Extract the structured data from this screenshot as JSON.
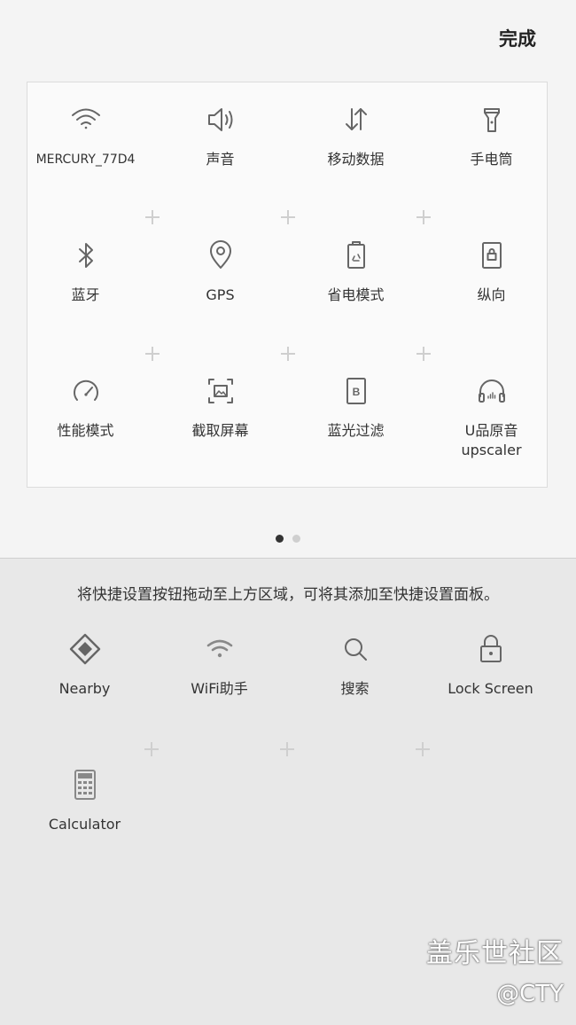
{
  "header": {
    "done_label": "完成"
  },
  "active_tiles": [
    {
      "label": "MERCURY_77D4",
      "icon": "wifi-icon"
    },
    {
      "label": "声音",
      "icon": "speaker-icon"
    },
    {
      "label": "移动数据",
      "icon": "mobile-data-icon"
    },
    {
      "label": "手电筒",
      "icon": "flashlight-icon"
    },
    {
      "label": "蓝牙",
      "icon": "bluetooth-icon"
    },
    {
      "label": "GPS",
      "icon": "location-pin-icon"
    },
    {
      "label": "省电模式",
      "icon": "battery-saver-icon"
    },
    {
      "label": "纵向",
      "icon": "portrait-lock-icon"
    },
    {
      "label": "性能模式",
      "icon": "speedometer-icon"
    },
    {
      "label": "截取屏幕",
      "icon": "screenshot-icon"
    },
    {
      "label": "蓝光过滤",
      "icon": "blue-light-filter-icon"
    },
    {
      "label": "U品原音\nupscaler",
      "icon": "headphones-icon"
    }
  ],
  "pagination": {
    "pages": 2,
    "current": 1
  },
  "available": {
    "instruction": "将快捷设置按钮拖动至上方区域，可将其添加至快捷设置面板。",
    "tiles": [
      {
        "label": "Nearby",
        "icon": "nearby-icon"
      },
      {
        "label": "WiFi助手",
        "icon": "wifi-assistant-icon"
      },
      {
        "label": "搜索",
        "icon": "search-icon"
      },
      {
        "label": "Lock Screen",
        "icon": "lock-icon"
      },
      {
        "label": "Calculator",
        "icon": "calculator-icon"
      }
    ]
  },
  "watermark": {
    "title": "盖乐世社区",
    "author": "@CTY"
  }
}
